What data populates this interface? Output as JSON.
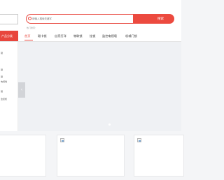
{
  "search": {
    "placeholder": "请输入搜索关键字",
    "button_label": "搜索",
    "hot_words": "热门搜索："
  },
  "category": {
    "title": "产品分类"
  },
  "nav": {
    "items": [
      {
        "label": "首页"
      },
      {
        "label": "磁卡锁"
      },
      {
        "label": "自亮打洋"
      },
      {
        "label": "物联锁"
      },
      {
        "label": "挂锁"
      },
      {
        "label": "监控电视墙"
      },
      {
        "label": "机械门锁"
      }
    ]
  },
  "sidebar": {
    "items": [
      {
        "label": "锁"
      },
      {
        "label": ""
      },
      {
        "label": "锁"
      },
      {
        "label": "锁"
      },
      {
        "label": "电视墙"
      },
      {
        "label": "锁"
      },
      {
        "label": "监控柜"
      }
    ]
  },
  "colors": {
    "accent": "#e8463d",
    "background": "#f4f5f7"
  }
}
